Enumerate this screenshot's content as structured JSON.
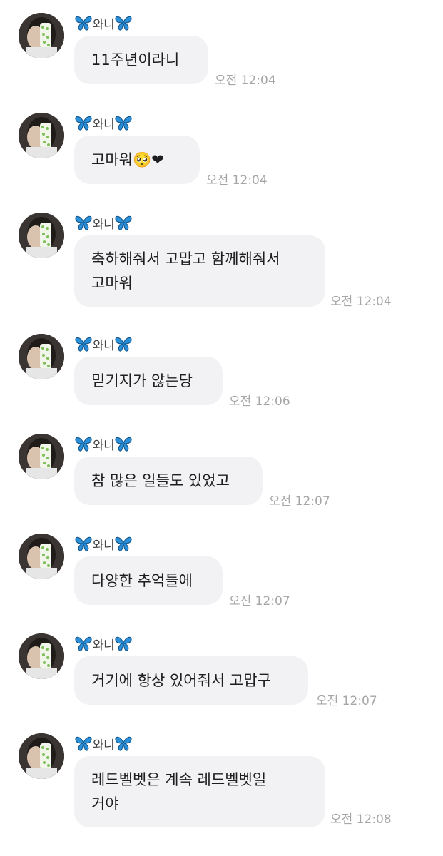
{
  "chat": {
    "sender_name": "와니",
    "sender_decoration_icon": "butterfly-icon",
    "accent_colors": {
      "bubble_bg": "#f2f2f5",
      "time_text": "#a6a6a6",
      "butterfly": "#2a8fd6"
    },
    "messages": [
      {
        "lines": [
          "11주년이라니"
        ],
        "time": "오전 12:04"
      },
      {
        "lines": [
          "고마워🥺❤"
        ],
        "time": "오전 12:04"
      },
      {
        "lines": [
          "축하해줘서 고맙고 함께해줘서",
          "고마워"
        ],
        "time": "오전 12:04"
      },
      {
        "lines": [
          "믿기지가 않는당"
        ],
        "time": "오전 12:06"
      },
      {
        "lines": [
          "참 많은 일들도 있었고"
        ],
        "time": "오전 12:07"
      },
      {
        "lines": [
          "다양한 추억들에"
        ],
        "time": "오전 12:07"
      },
      {
        "lines": [
          "거기에 항상 있어줘서 고맙구"
        ],
        "time": "오전 12:07"
      },
      {
        "lines": [
          "레드벨벳은 계속 레드벨벳일",
          "거야"
        ],
        "time": "오전 12:08"
      }
    ]
  }
}
